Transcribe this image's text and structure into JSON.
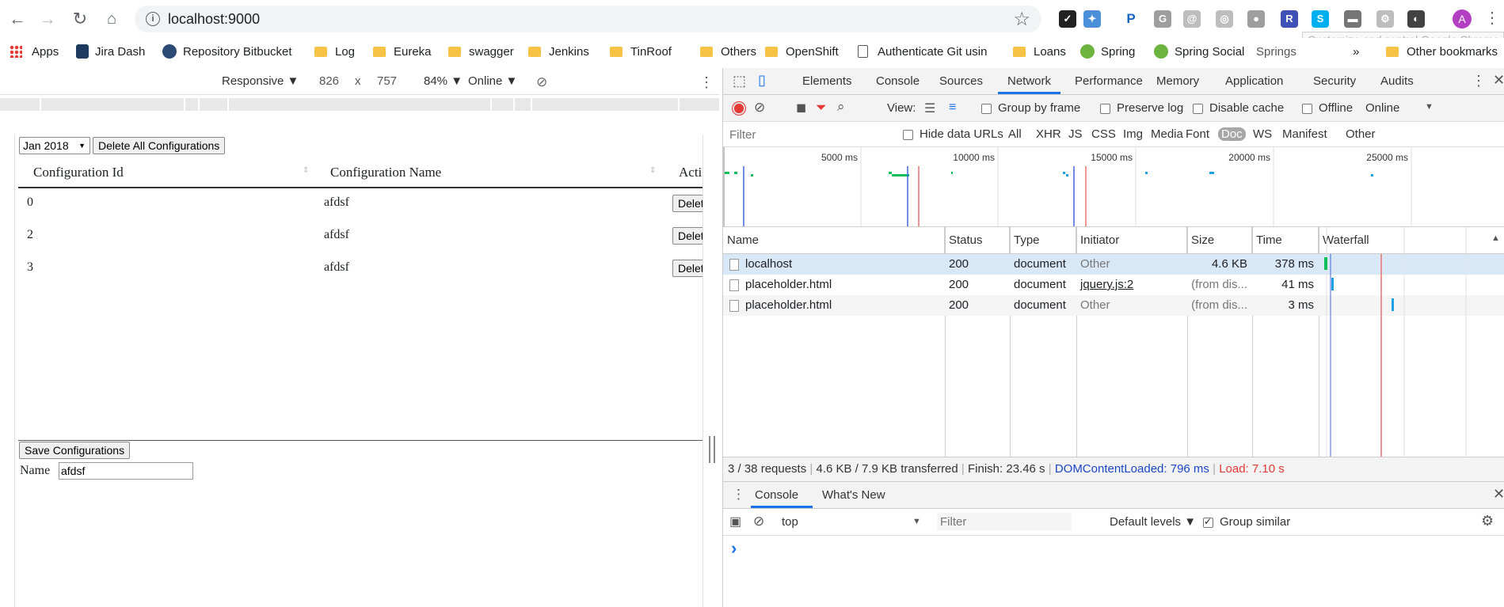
{
  "browser": {
    "url": "localhost:9000",
    "extensions": [
      {
        "name": "ext-1",
        "color": "#222222",
        "glyph": "✓"
      },
      {
        "name": "ext-2",
        "color": "#4a90d9",
        "glyph": "✦"
      },
      {
        "name": "ext-paypal",
        "color": "#ffffff",
        "glyph": "P"
      },
      {
        "name": "ext-4",
        "color": "#9e9e9e",
        "glyph": "G"
      },
      {
        "name": "ext-5",
        "color": "#bdbdbd",
        "glyph": "@"
      },
      {
        "name": "ext-6",
        "color": "#bdbdbd",
        "glyph": "◎"
      },
      {
        "name": "ext-7",
        "color": "#9e9e9e",
        "glyph": "●"
      },
      {
        "name": "ext-8",
        "color": "#3f51b5",
        "glyph": "R"
      },
      {
        "name": "ext-skype",
        "color": "#00aff0",
        "glyph": "S"
      },
      {
        "name": "ext-10",
        "color": "#757575",
        "glyph": "▬"
      },
      {
        "name": "ext-11",
        "color": "#bdbdbd",
        "glyph": "⚙"
      },
      {
        "name": "ext-12",
        "color": "#424242",
        "glyph": "◐"
      }
    ],
    "profile_initial": "A",
    "tooltip": "Customize and control Google Chrome"
  },
  "bookmarks": {
    "items": [
      {
        "label": "Apps",
        "kind": "apps"
      },
      {
        "label": "Jira Dash",
        "kind": "jira"
      },
      {
        "label": "Repository Bitbucket",
        "kind": "bitbucket"
      },
      {
        "label": "Log",
        "kind": "folder"
      },
      {
        "label": "Eureka",
        "kind": "folder"
      },
      {
        "label": "swagger",
        "kind": "folder"
      },
      {
        "label": "Jenkins",
        "kind": "folder"
      },
      {
        "label": "TinRoof",
        "kind": "folder"
      },
      {
        "label": "Others",
        "kind": "folder"
      },
      {
        "label": "OpenShift",
        "kind": "folder"
      },
      {
        "label": "Authenticate Git usin",
        "kind": "page"
      },
      {
        "label": "Loans",
        "kind": "folder"
      },
      {
        "label": "Spring",
        "kind": "spring"
      },
      {
        "label": "Spring Social",
        "kind": "spring"
      },
      {
        "label": "Springs",
        "kind": "text"
      }
    ],
    "overflow": "»",
    "other": "Other bookmarks"
  },
  "device_toolbar": {
    "mode": "Responsive ▼",
    "width": "826",
    "times": "x",
    "height": "757",
    "zoom": "84% ▼",
    "network": "Online ▼"
  },
  "page": {
    "month_select": "Jan 2018",
    "delete_all_button": "Delete All Configurations",
    "columns": [
      "Configuration Id",
      "Configuration Name",
      "Acti"
    ],
    "rows": [
      {
        "id": "0",
        "name": "afdsf",
        "action": "Delet"
      },
      {
        "id": "2",
        "name": "afdsf",
        "action": "Delet"
      },
      {
        "id": "3",
        "name": "afdsf",
        "action": "Delet"
      }
    ],
    "save_button": "Save Configurations",
    "name_label": "Name",
    "name_value": "afdsf"
  },
  "devtools": {
    "tabs": [
      "Elements",
      "Console",
      "Sources",
      "Network",
      "Performance",
      "Memory",
      "Application",
      "Security",
      "Audits"
    ],
    "active_tab": "Network",
    "net_toolbar": {
      "view_label": "View:",
      "group_by_frame": "Group by frame",
      "preserve_log": "Preserve log",
      "disable_cache": "Disable cache",
      "offline": "Offline",
      "throttle": "Online"
    },
    "filter": {
      "placeholder": "Filter",
      "hide_data_urls": "Hide data URLs",
      "types": [
        "All",
        "XHR",
        "JS",
        "CSS",
        "Img",
        "Media",
        "Font",
        "Doc",
        "WS",
        "Manifest",
        "Other"
      ],
      "active_type": "Doc"
    },
    "overview_ticks": [
      "5000 ms",
      "10000 ms",
      "15000 ms",
      "20000 ms",
      "25000 ms"
    ],
    "columns": [
      "Name",
      "Status",
      "Type",
      "Initiator",
      "Size",
      "Time",
      "Waterfall"
    ],
    "requests": [
      {
        "name": "localhost",
        "status": "200",
        "type": "document",
        "initiator": "Other",
        "size": "4.6 KB",
        "time": "378 ms"
      },
      {
        "name": "placeholder.html",
        "status": "200",
        "type": "document",
        "initiator": "jquery.js:2",
        "size": "(from dis...",
        "time": "41 ms"
      },
      {
        "name": "placeholder.html",
        "status": "200",
        "type": "document",
        "initiator": "Other",
        "size": "(from dis...",
        "time": "3 ms"
      }
    ],
    "status_bar": {
      "requests": "3 / 38 requests",
      "transferred": "4.6 KB / 7.9 KB transferred",
      "finish": "Finish: 23.46 s",
      "dcl": "DOMContentLoaded: 796 ms",
      "load": "Load: 7.10 s"
    },
    "drawer": {
      "tabs": [
        "Console",
        "What's New"
      ],
      "context": "top",
      "filter_placeholder": "Filter",
      "levels": "Default levels ▼",
      "group_similar": "Group similar",
      "prompt": "›"
    }
  }
}
